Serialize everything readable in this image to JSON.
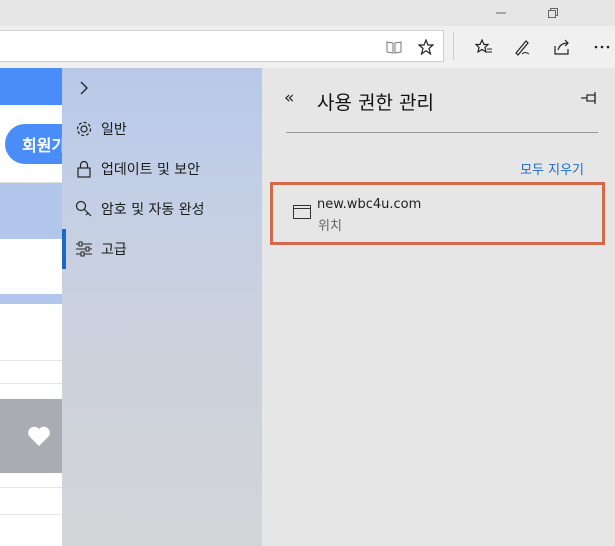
{
  "window": {
    "minimize_icon": "minimize-icon",
    "restore_icon": "restore-icon"
  },
  "toolbar": {
    "reading_view_icon": "book-icon",
    "favorite_icon": "star-icon",
    "favorites_icon": "star-list-icon",
    "notes_icon": "pen-icon",
    "share_icon": "share-icon",
    "more_icon": "more-icon"
  },
  "page": {
    "signup_partial": "회원가"
  },
  "settings_nav": {
    "expand_label": ">",
    "items": [
      {
        "label": "일반",
        "icon": "gear-icon"
      },
      {
        "label": "업데이트 및 보안",
        "icon": "lock-icon"
      },
      {
        "label": "암호 및 자동 완성",
        "icon": "key-icon"
      },
      {
        "label": "고급",
        "icon": "sliders-icon",
        "selected": true
      }
    ]
  },
  "panel": {
    "back_label": "«",
    "title": "사용 권한 관리",
    "pin_icon": "pin-icon",
    "clear_all": "모두 지우기",
    "sites": [
      {
        "url": "new.wbc4u.com",
        "permission": "위치",
        "icon": "window-icon"
      }
    ]
  },
  "colors": {
    "accent": "#1b6ac9",
    "highlight_border": "#d2694a",
    "page_blue": "#4a8df8"
  }
}
